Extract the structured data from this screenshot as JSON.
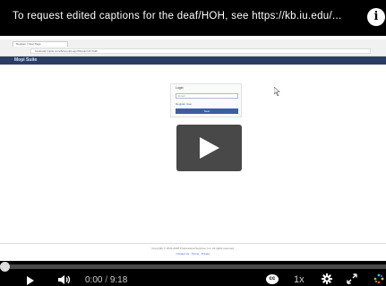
{
  "title_bar": {
    "title": "To request edited captions for the deaf/HOH, see https://kb.iu.edu/...",
    "info_icon_glyph": "i"
  },
  "embedded_page": {
    "tab_label": "Register / Next Page",
    "address": "hostmattr.tmpsk.com/Account/Login?ReturnUrl=%2F",
    "app_logo": "Mopi Suite",
    "login_title": "Login",
    "input_placeholder": "Email",
    "register_link": "Register User",
    "next_button": "Next",
    "footer_copyright": "Copyright © 2011-2018 Professional Services, Inc. All rights reserved.",
    "footer_links": "Contact Us · Terms · Privacy"
  },
  "controls": {
    "current_time": "0:00",
    "separator": "/",
    "duration": "9:18",
    "cc_label": "cc",
    "speed": "1x",
    "progress": 0.0
  },
  "colors": {
    "app_header": "#2b3d63",
    "primary_button": "#3c5ea8"
  },
  "icons": [
    "info-icon",
    "play-icon",
    "volume-icon",
    "cc-icon",
    "settings-icon",
    "fullscreen-icon",
    "kaltura-icon"
  ]
}
